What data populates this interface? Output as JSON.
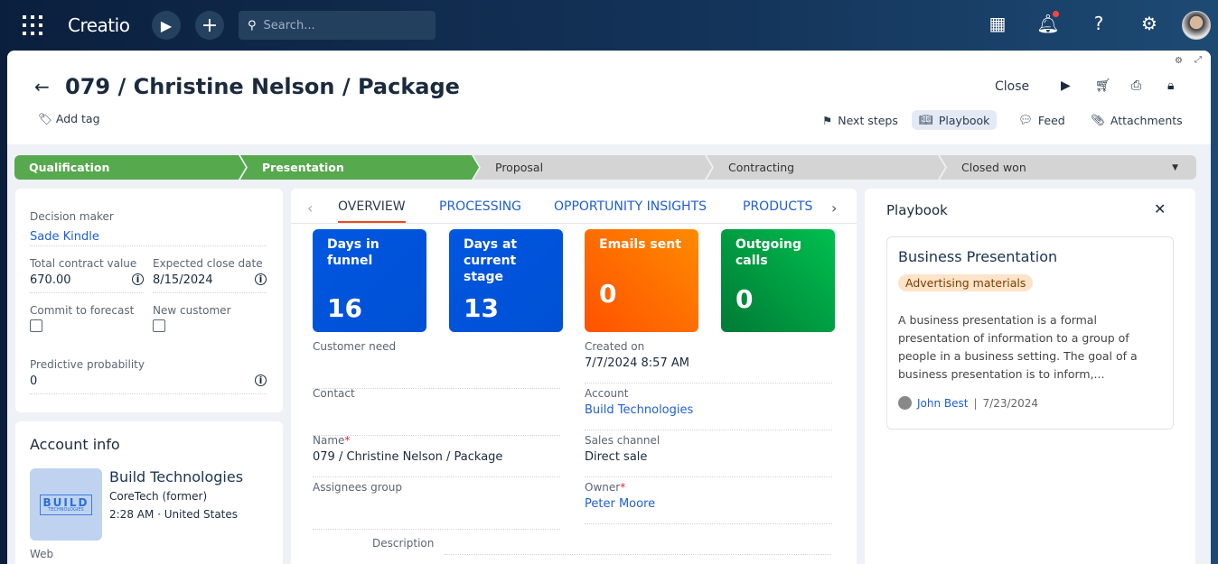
{
  "topbar": {
    "logo": "Creatio",
    "search_placeholder": "Search..."
  },
  "header": {
    "title": "079 / Christine Nelson / Package",
    "add_tag": "Add tag",
    "close": "Close",
    "tabs": [
      "Next steps",
      "Playbook",
      "Feed",
      "Attachments"
    ],
    "active_tab": "Playbook"
  },
  "stages": [
    {
      "label": "Qualification",
      "done": true
    },
    {
      "label": "Presentation",
      "done": true
    },
    {
      "label": "Proposal",
      "done": false
    },
    {
      "label": "Contracting",
      "done": false
    },
    {
      "label": "Closed won",
      "done": false
    }
  ],
  "left": {
    "decision_maker_label": "Decision maker",
    "decision_maker": "Sade Kindle",
    "total_label": "Total contract value",
    "total": "670.00",
    "close_date_label": "Expected close date",
    "close_date": "8/15/2024",
    "commit_label": "Commit to forecast",
    "new_customer_label": "New customer",
    "probability_label": "Predictive probability",
    "probability": "0"
  },
  "account": {
    "title": "Account info",
    "name": "Build Technologies",
    "former": "CoreTech (former)",
    "time": "2:28 AM · United States",
    "web_label": "Web",
    "logo_text": "BUILD",
    "logo_sub": "TECHNOLOGIES"
  },
  "center": {
    "tabs": [
      "OVERVIEW",
      "PROCESSING",
      "OPPORTUNITY INSIGHTS",
      "PRODUCTS"
    ],
    "tiles": [
      {
        "label": "Days in funnel",
        "value": "16",
        "color": "#0057e0"
      },
      {
        "label": "Days at current stage",
        "value": "13",
        "color": "#0057e0"
      },
      {
        "label": "Emails sent",
        "value": "0",
        "color": "#ff6a00"
      },
      {
        "label": "Outgoing calls",
        "value": "0",
        "color": "#00a84a"
      }
    ],
    "fields": {
      "customer_need_label": "Customer need",
      "created_label": "Created on",
      "created": "7/7/2024 8:57 AM",
      "contact_label": "Contact",
      "account_label": "Account",
      "account": "Build Technologies",
      "name_label": "Name",
      "name": "079 / Christine Nelson / Package",
      "channel_label": "Sales channel",
      "channel": "Direct sale",
      "assignees_label": "Assignees group",
      "owner_label": "Owner",
      "owner": "Peter Moore",
      "description_label": "Description"
    }
  },
  "playbook": {
    "title": "Playbook",
    "card_title": "Business Presentation",
    "tag": "Advertising materials",
    "text": "A business presentation is a formal presentation of information to a group of people in a business setting. The goal of a business presentation is to inform,...",
    "author": "John Best",
    "date": "7/23/2024"
  }
}
